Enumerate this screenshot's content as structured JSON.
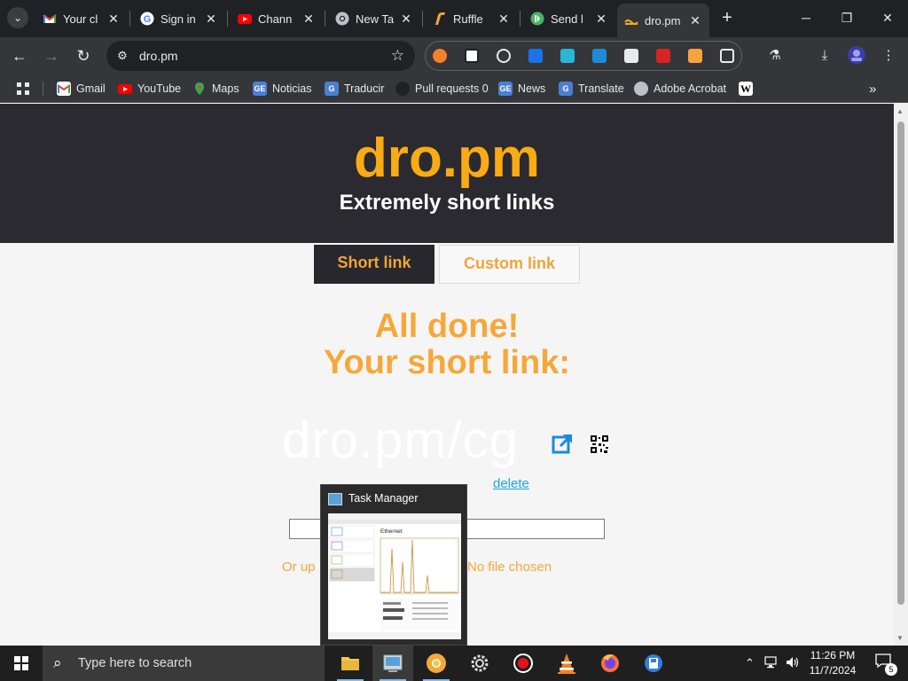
{
  "browser": {
    "tabs": [
      {
        "title": "Your cl",
        "favicon": "gmail-icon",
        "active": false
      },
      {
        "title": "Sign in",
        "favicon": "google-icon",
        "active": false
      },
      {
        "title": "Chann",
        "favicon": "youtube-icon",
        "active": false
      },
      {
        "title": "New Ta",
        "favicon": "chrome-icon",
        "active": false
      },
      {
        "title": "Ruffle",
        "favicon": "ruffle-icon",
        "active": false
      },
      {
        "title": "Send l",
        "favicon": "pushbullet-icon",
        "active": false
      },
      {
        "title": "dro.pm",
        "favicon": "dro-pm-icon",
        "active": true
      }
    ],
    "url": "dro.pm",
    "bookmarks": [
      {
        "label": "Gmail",
        "icon": "gmail-icon"
      },
      {
        "label": "YouTube",
        "icon": "youtube-icon"
      },
      {
        "label": "Maps",
        "icon": "maps-icon"
      },
      {
        "label": "Noticias",
        "icon": "google-news-icon"
      },
      {
        "label": "Traducir",
        "icon": "google-translate-icon"
      },
      {
        "label": "Pull requests 0",
        "icon": "github-icon"
      },
      {
        "label": "News",
        "icon": "google-news-icon"
      },
      {
        "label": "Translate",
        "icon": "google-translate-icon"
      },
      {
        "label": "Adobe Acrobat",
        "icon": "adobe-acrobat-icon"
      },
      {
        "label": "W",
        "icon": "wikipedia-icon"
      }
    ],
    "colors": {
      "chrome_dark": "#202124",
      "toolbar": "#35363a"
    }
  },
  "page": {
    "brand": "dro.pm",
    "tagline": "Extremely short links",
    "tabs": [
      "Short link",
      "Custom link"
    ],
    "done_line1": "All done!",
    "done_line2": "Your short link:",
    "short_link": "dro.pm/cg",
    "delete_label": "delete",
    "upload_left": "Or up",
    "upload_right": "No file chosen",
    "colors": {
      "accent": "#f9ab15",
      "header_bg": "#2a2a30",
      "link": "#1aa6e8"
    }
  },
  "task_manager_preview": {
    "title": "Task Manager",
    "section": "Ethernet"
  },
  "taskbar": {
    "search_placeholder": "Type here to search",
    "apps": [
      "file-explorer-icon",
      "task-manager-icon",
      "chrome-canary-icon",
      "settings-icon",
      "screen-recorder-icon",
      "vlc-icon",
      "firefox-icon",
      "save-app-icon"
    ],
    "time": "11:26 PM",
    "date": "11/7/2024",
    "notification_count": "5"
  }
}
